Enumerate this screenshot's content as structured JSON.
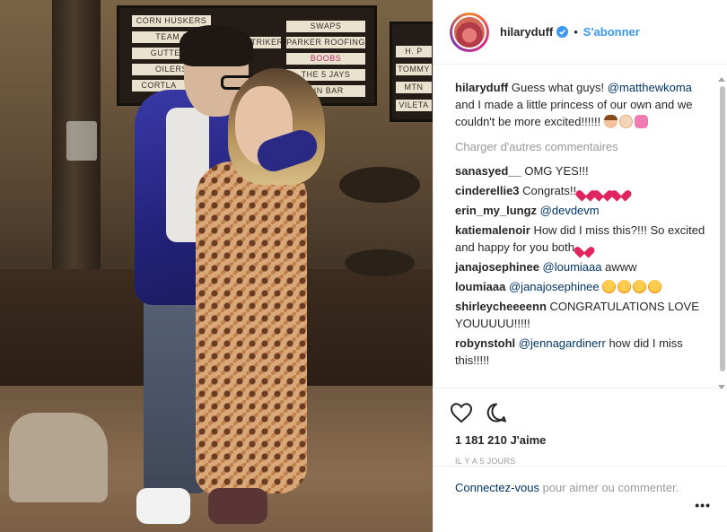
{
  "post": {
    "photo": {
      "scoreboard_left": [
        "CORN HUSKERS",
        "TEAM 1",
        "GUTTERS",
        "OILERS",
        "CORTLA"
      ],
      "scoreboard_mid": [
        "SWAPS",
        "STRIKERS",
        "PARKER ROOFING",
        "BOOBS",
        "THE 5 JAYS",
        "PIN BAR"
      ],
      "scoreboard_right": [
        "H. P",
        "TOMMY",
        "MTN",
        "VILETA"
      ]
    },
    "header": {
      "username": "hilaryduff",
      "separator": "•",
      "follow_label": "S'abonner",
      "icon": "verified-badge-icon",
      "accent": "#3897f0"
    },
    "caption": {
      "username": "hilaryduff",
      "text_1": " Guess what guys! ",
      "mention": "@matthewkoma",
      "text_2": " and I made a little princess of our own and we couldn't be more excited!!!!!! ",
      "emojis": [
        "girl-emoji-icon",
        "baby-emoji-icon",
        "ribbon-emoji-icon"
      ]
    },
    "load_more_label": "Charger d'autres commentaires",
    "comments": [
      {
        "username": "sanasyed__",
        "text": " OMG YES!!!"
      },
      {
        "username": "cinderellie3",
        "text": " Congrats!! ",
        "emojis": [
          "heart-icon",
          "heart-icon",
          "heart-icon"
        ]
      },
      {
        "username": "erin_my_lungz",
        "text": " ",
        "mention": "@devdevm"
      },
      {
        "username": "katiemalenoir",
        "text": " How did I miss this?!!! So excited and happy for you both ",
        "emojis": [
          "heart-with-ribbon-icon"
        ]
      },
      {
        "username": "janajosephinee",
        "text": " ",
        "mention": "@loumiaaa",
        "text_after": " awww"
      },
      {
        "username": "loumiaaa",
        "text": " ",
        "mention": "@janajosephinee",
        "text_after": " ",
        "emojis": [
          "star-eyes-icon",
          "star-eyes-icon",
          "star-eyes-icon",
          "star-eyes-icon"
        ]
      },
      {
        "username": "shirleycheeeenn",
        "text": " CONGRATULATIONS LOVE YOUUUUU!!!!!"
      },
      {
        "username": "robynstohl",
        "text": " ",
        "mention": "@jennagardinerr",
        "text_after": " how did I miss this!!!!!"
      }
    ],
    "actions": {
      "like_icon": "heart-outline-icon",
      "comment_icon": "comment-bubble-icon"
    },
    "likes_label": "1 181 210 J'aime",
    "time_label": "IL Y A 5 JOURS",
    "login": {
      "link_label": "Connectez-vous",
      "text": " pour aimer ou commenter."
    },
    "more_label": "•••"
  }
}
